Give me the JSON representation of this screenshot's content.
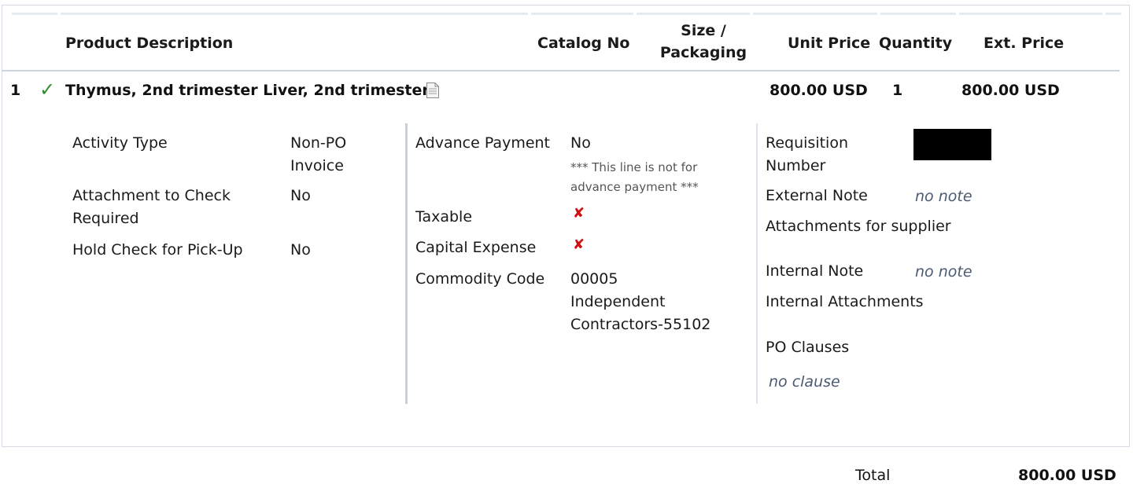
{
  "columns": {
    "product_description": "Product Description",
    "catalog_no": "Catalog No",
    "size_packaging_line1": "Size /",
    "size_packaging_line2": "Packaging",
    "unit_price": "Unit Price",
    "quantity": "Quantity",
    "ext_price": "Ext. Price"
  },
  "line_item": {
    "number": "1",
    "status_icon": "checkmark-icon",
    "description": "Thymus, 2nd trimester Liver, 2nd trimester",
    "doc_icon": "document-icon",
    "unit_price": "800.00 USD",
    "quantity": "1",
    "ext_price": "800.00 USD"
  },
  "details": {
    "activity_type_label": "Activity Type",
    "activity_type_value_line1": "Non-PO",
    "activity_type_value_line2": "Invoice",
    "attachment_check_label_line1": "Attachment to Check",
    "attachment_check_label_line2": "Required",
    "attachment_check_value": "No",
    "hold_check_label": "Hold Check for Pick-Up",
    "hold_check_value": "No",
    "advance_payment_label": "Advance Payment",
    "advance_payment_value": "No",
    "advance_payment_note_line1": "*** This line is not for",
    "advance_payment_note_line2": "advance payment ***",
    "taxable_label": "Taxable",
    "taxable_icon": "x-icon",
    "capital_expense_label": "Capital Expense",
    "capital_expense_icon": "x-icon",
    "commodity_code_label": "Commodity Code",
    "commodity_code_line1": "00005",
    "commodity_code_line2": "Independent",
    "commodity_code_line3": "Contractors-55102",
    "requisition_number_label_line1": "Requisition",
    "requisition_number_label_line2": "Number",
    "external_note_label": "External Note",
    "external_note_value": "no note",
    "attachments_supplier_label": "Attachments for supplier",
    "internal_note_label": "Internal Note",
    "internal_note_value": "no note",
    "internal_attachments_label": "Internal Attachments",
    "po_clauses_label": "PO Clauses",
    "po_clauses_value": "no clause"
  },
  "footer": {
    "total_label": "Total",
    "total_value": "800.00 USD"
  },
  "colors": {
    "check_green": "#2e8b2e",
    "x_red": "#d01010",
    "note_gray_blue": "#4a5a70",
    "separator": "#c5d0df"
  }
}
